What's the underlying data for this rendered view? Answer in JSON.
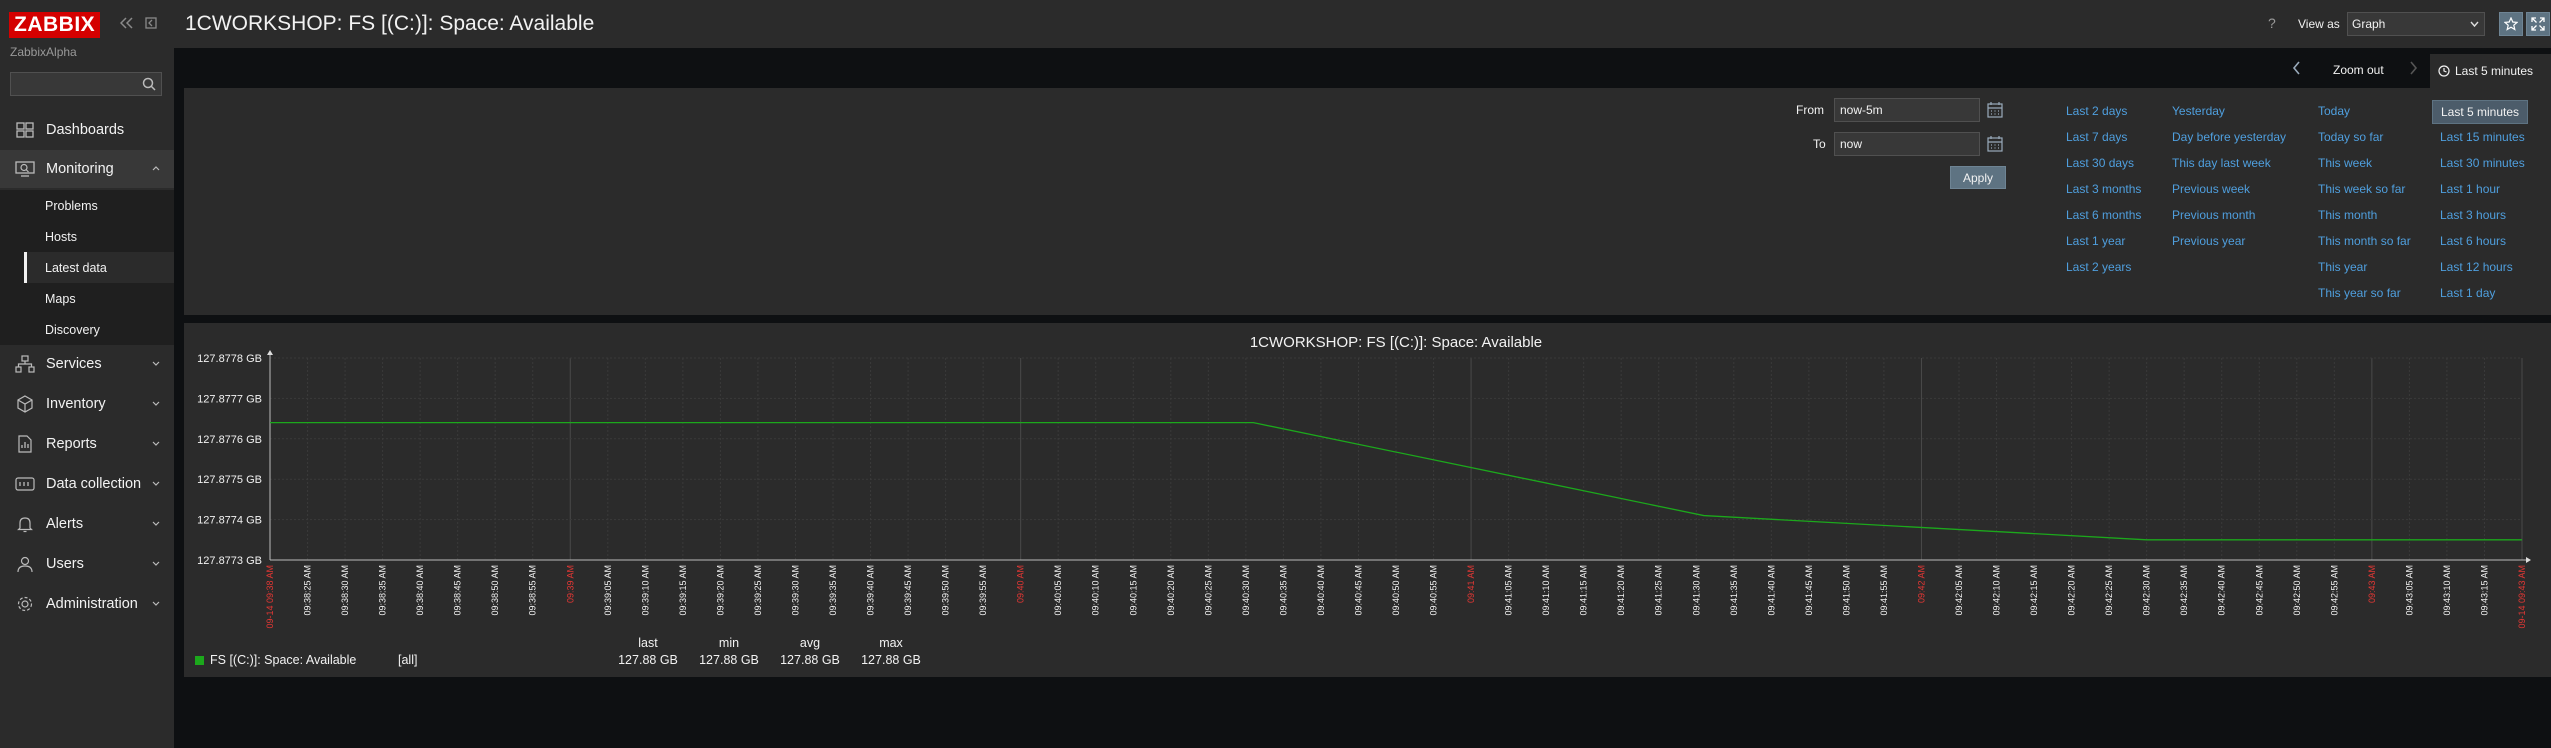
{
  "app": {
    "logo": "ZABBIX",
    "instance": "ZabbixAlpha",
    "search_placeholder": ""
  },
  "sidebar": {
    "menu": [
      {
        "label": "Dashboards",
        "icon": "dashboard-icon"
      },
      {
        "label": "Monitoring",
        "icon": "monitoring-icon",
        "expanded": true
      },
      {
        "label": "Services",
        "icon": "services-icon"
      },
      {
        "label": "Inventory",
        "icon": "inventory-icon"
      },
      {
        "label": "Reports",
        "icon": "reports-icon"
      },
      {
        "label": "Data collection",
        "icon": "data-collection-icon"
      },
      {
        "label": "Alerts",
        "icon": "alerts-icon"
      },
      {
        "label": "Users",
        "icon": "users-icon"
      },
      {
        "label": "Administration",
        "icon": "administration-icon"
      }
    ],
    "monitoring_submenu": [
      "Problems",
      "Hosts",
      "Latest data",
      "Maps",
      "Discovery"
    ],
    "active_submenu": "Latest data"
  },
  "header": {
    "title": "1CWORKSHOP: FS [(C:)]: Space: Available",
    "help": "?",
    "view_as_label": "View as",
    "view_as_value": "Graph"
  },
  "filter": {
    "zoom_out": "Zoom out",
    "tab_label": "Last 5 minutes",
    "from_label": "From",
    "from_value": "now-5m",
    "to_label": "To",
    "to_value": "now",
    "apply": "Apply",
    "quick_ranges": [
      [
        "Last 2 days",
        "Last 7 days",
        "Last 30 days",
        "Last 3 months",
        "Last 6 months",
        "Last 1 year",
        "Last 2 years"
      ],
      [
        "Yesterday",
        "Day before yesterday",
        "This day last week",
        "Previous week",
        "Previous month",
        "Previous year"
      ],
      [
        "Today",
        "Today so far",
        "This week",
        "This week so far",
        "This month",
        "This month so far",
        "This year",
        "This year so far"
      ],
      [
        "Last 5 minutes",
        "Last 15 minutes",
        "Last 30 minutes",
        "Last 1 hour",
        "Last 3 hours",
        "Last 6 hours",
        "Last 12 hours",
        "Last 1 day"
      ]
    ],
    "selected_range": "Last 5 minutes"
  },
  "graph": {
    "legend": {
      "headers": [
        "last",
        "min",
        "avg",
        "max"
      ],
      "items": [
        {
          "name": "FS [(C:)]: Space: Available",
          "function": "[all]",
          "values": [
            "127.88 GB",
            "127.88 GB",
            "127.88 GB",
            "127.88 GB"
          ],
          "color": "#1ca81c"
        }
      ]
    }
  },
  "chart_data": {
    "type": "line",
    "title": "1CWORKSHOP: FS [(C:)]: Space: Available",
    "y_ticks": [
      "127.8778 GB",
      "127.8777 GB",
      "127.8776 GB",
      "127.8775 GB",
      "127.8774 GB",
      "127.8773 GB"
    ],
    "ylim": [
      127.8773,
      127.8778
    ],
    "x_ticks": [
      "09-14 09:38 AM",
      "09:38:25 AM",
      "09:38:30 AM",
      "09:38:35 AM",
      "09:38:40 AM",
      "09:38:45 AM",
      "09:38:50 AM",
      "09:38:55 AM",
      "09:39 AM",
      "09:39:05 AM",
      "09:39:10 AM",
      "09:39:15 AM",
      "09:39:20 AM",
      "09:39:25 AM",
      "09:39:30 AM",
      "09:39:35 AM",
      "09:39:40 AM",
      "09:39:45 AM",
      "09:39:50 AM",
      "09:39:55 AM",
      "09:40 AM",
      "09:40:05 AM",
      "09:40:10 AM",
      "09:40:15 AM",
      "09:40:20 AM",
      "09:40:25 AM",
      "09:40:30 AM",
      "09:40:35 AM",
      "09:40:40 AM",
      "09:40:45 AM",
      "09:40:50 AM",
      "09:40:55 AM",
      "09:41 AM",
      "09:41:05 AM",
      "09:41:10 AM",
      "09:41:15 AM",
      "09:41:20 AM",
      "09:41:25 AM",
      "09:41:30 AM",
      "09:41:35 AM",
      "09:41:40 AM",
      "09:41:45 AM",
      "09:41:50 AM",
      "09:41:55 AM",
      "09:42 AM",
      "09:42:05 AM",
      "09:42:10 AM",
      "09:42:15 AM",
      "09:42:20 AM",
      "09:42:25 AM",
      "09:42:30 AM",
      "09:42:35 AM",
      "09:42:40 AM",
      "09:42:45 AM",
      "09:42:50 AM",
      "09:42:55 AM",
      "09:43 AM",
      "09:43:05 AM",
      "09:43:10 AM",
      "09:43:15 AM",
      "09-14 09:43 AM"
    ],
    "major_ticks": [
      "09-14 09:38 AM",
      "09:39 AM",
      "09:40 AM",
      "09:41 AM",
      "09:42 AM",
      "09:43 AM",
      "09-14 09:43 AM"
    ],
    "series": [
      {
        "name": "FS [(C:)]: Space: Available",
        "color": "#1ca81c",
        "x_tick_index": [
          0,
          26.2,
          38.2,
          50.0,
          60.0
        ],
        "values": [
          127.87764,
          127.87764,
          127.87741,
          127.87735,
          127.87735
        ]
      }
    ],
    "grid": true
  }
}
